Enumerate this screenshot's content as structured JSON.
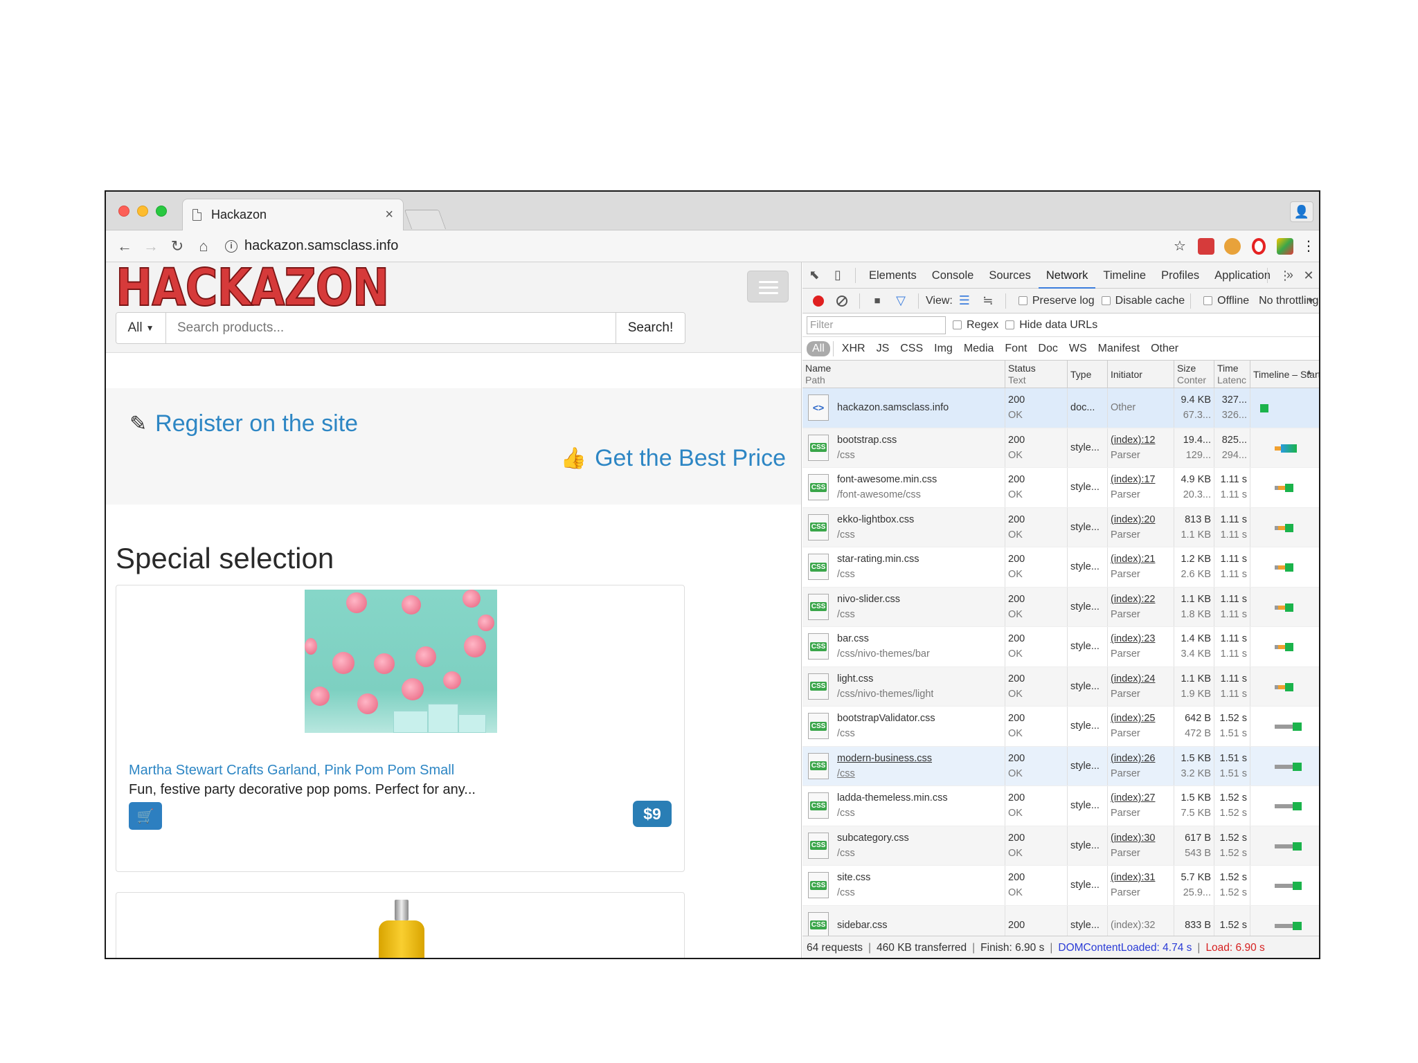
{
  "browser": {
    "tab_title": "Hackazon",
    "tab_close": "×",
    "url": "hackazon.samsclass.info"
  },
  "page": {
    "logo_text": "HACKAZON",
    "search": {
      "category": "All",
      "placeholder": "Search products...",
      "button": "Search!"
    },
    "promo": {
      "register": "Register on the site",
      "best_price": "Get the Best Price"
    },
    "section_title": "Special selection",
    "product": {
      "name": "Martha Stewart Crafts Garland, Pink Pom Pom Small",
      "description": "Fun, festive party decorative pop poms. Perfect for any...",
      "price": "$9"
    }
  },
  "devtools": {
    "tabs": [
      "Elements",
      "Console",
      "Sources",
      "Network",
      "Timeline",
      "Profiles",
      "Application"
    ],
    "active_tab": "Network",
    "toolbar": {
      "view_label": "View:",
      "preserve_log": "Preserve log",
      "disable_cache": "Disable cache",
      "offline": "Offline",
      "throttling": "No throttling"
    },
    "filter": {
      "placeholder": "Filter",
      "regex": "Regex",
      "hide_data_urls": "Hide data URLs"
    },
    "types": [
      "All",
      "XHR",
      "JS",
      "CSS",
      "Img",
      "Media",
      "Font",
      "Doc",
      "WS",
      "Manifest",
      "Other"
    ],
    "columns": {
      "name": "Name",
      "path": "Path",
      "status": "Status",
      "text": "Text",
      "type": "Type",
      "initiator": "Initiator",
      "size": "Size",
      "content": "Conter",
      "time": "Time",
      "latency": "Latenc",
      "timeline": "Timeline – Start Time"
    },
    "rows": [
      {
        "name": "hackazon.samsclass.info",
        "path": "",
        "status": "200",
        "text": "OK",
        "type": "doc...",
        "initiator": "Other",
        "init_sub": "",
        "size": "9.4 KB",
        "content": "67.3...",
        "time": "327...",
        "latency": "326...",
        "icon": "html",
        "start": 0.01,
        "wait": 0.0,
        "recv": 0.05
      },
      {
        "name": "bootstrap.css",
        "path": "/css",
        "status": "200",
        "text": "OK",
        "type": "style...",
        "initiator": "(index):12",
        "init_sub": "Parser",
        "size": "19.4...",
        "content": "129...",
        "time": "825...",
        "latency": "294...",
        "icon": "css",
        "start": 0.12,
        "wait": 0.05,
        "recv": 0.09
      },
      {
        "name": "font-awesome.min.css",
        "path": "/font-awesome/css",
        "status": "200",
        "text": "OK",
        "type": "style...",
        "initiator": "(index):17",
        "init_sub": "Parser",
        "size": "4.9 KB",
        "content": "20.3...",
        "time": "1.11 s",
        "latency": "1.11 s",
        "icon": "css",
        "start": 0.12,
        "wait": 0.08,
        "recv": 0.05
      },
      {
        "name": "ekko-lightbox.css",
        "path": "/css",
        "status": "200",
        "text": "OK",
        "type": "style...",
        "initiator": "(index):20",
        "init_sub": "Parser",
        "size": "813 B",
        "content": "1.1 KB",
        "time": "1.11 s",
        "latency": "1.11 s",
        "icon": "css",
        "start": 0.12,
        "wait": 0.08,
        "recv": 0.05
      },
      {
        "name": "star-rating.min.css",
        "path": "/css",
        "status": "200",
        "text": "OK",
        "type": "style...",
        "initiator": "(index):21",
        "init_sub": "Parser",
        "size": "1.2 KB",
        "content": "2.6 KB",
        "time": "1.11 s",
        "latency": "1.11 s",
        "icon": "css",
        "start": 0.12,
        "wait": 0.08,
        "recv": 0.05
      },
      {
        "name": "nivo-slider.css",
        "path": "/css",
        "status": "200",
        "text": "OK",
        "type": "style...",
        "initiator": "(index):22",
        "init_sub": "Parser",
        "size": "1.1 KB",
        "content": "1.8 KB",
        "time": "1.11 s",
        "latency": "1.11 s",
        "icon": "css",
        "start": 0.12,
        "wait": 0.08,
        "recv": 0.05
      },
      {
        "name": "bar.css",
        "path": "/css/nivo-themes/bar",
        "status": "200",
        "text": "OK",
        "type": "style...",
        "initiator": "(index):23",
        "init_sub": "Parser",
        "size": "1.4 KB",
        "content": "3.4 KB",
        "time": "1.11 s",
        "latency": "1.11 s",
        "icon": "css",
        "start": 0.12,
        "wait": 0.08,
        "recv": 0.05
      },
      {
        "name": "light.css",
        "path": "/css/nivo-themes/light",
        "status": "200",
        "text": "OK",
        "type": "style...",
        "initiator": "(index):24",
        "init_sub": "Parser",
        "size": "1.1 KB",
        "content": "1.9 KB",
        "time": "1.11 s",
        "latency": "1.11 s",
        "icon": "css",
        "start": 0.12,
        "wait": 0.08,
        "recv": 0.05
      },
      {
        "name": "bootstrapValidator.css",
        "path": "/css",
        "status": "200",
        "text": "OK",
        "type": "style...",
        "initiator": "(index):25",
        "init_sub": "Parser",
        "size": "642 B",
        "content": "472 B",
        "time": "1.52 s",
        "latency": "1.51 s",
        "icon": "css",
        "start": 0.12,
        "wait": 0.14,
        "recv": 0.05
      },
      {
        "name": "modern-business.css",
        "path": "/css",
        "status": "200",
        "text": "OK",
        "type": "style...",
        "initiator": "(index):26",
        "init_sub": "Parser",
        "size": "1.5 KB",
        "content": "3.2 KB",
        "time": "1.51 s",
        "latency": "1.51 s",
        "icon": "css",
        "start": 0.12,
        "wait": 0.14,
        "recv": 0.05
      },
      {
        "name": "ladda-themeless.min.css",
        "path": "/css",
        "status": "200",
        "text": "OK",
        "type": "style...",
        "initiator": "(index):27",
        "init_sub": "Parser",
        "size": "1.5 KB",
        "content": "7.5 KB",
        "time": "1.52 s",
        "latency": "1.52 s",
        "icon": "css",
        "start": 0.12,
        "wait": 0.14,
        "recv": 0.05
      },
      {
        "name": "subcategory.css",
        "path": "/css",
        "status": "200",
        "text": "OK",
        "type": "style...",
        "initiator": "(index):30",
        "init_sub": "Parser",
        "size": "617 B",
        "content": "543 B",
        "time": "1.52 s",
        "latency": "1.52 s",
        "icon": "css",
        "start": 0.12,
        "wait": 0.14,
        "recv": 0.05
      },
      {
        "name": "site.css",
        "path": "/css",
        "status": "200",
        "text": "OK",
        "type": "style...",
        "initiator": "(index):31",
        "init_sub": "Parser",
        "size": "5.7 KB",
        "content": "25.9...",
        "time": "1.52 s",
        "latency": "1.52 s",
        "icon": "css",
        "start": 0.12,
        "wait": 0.14,
        "recv": 0.05
      },
      {
        "name": "sidebar.css",
        "path": "",
        "status": "200",
        "text": "",
        "type": "style...",
        "initiator": "(index):32",
        "init_sub": "",
        "size": "833 B",
        "content": "",
        "time": "1.52 s",
        "latency": "",
        "icon": "css",
        "start": 0.12,
        "wait": 0.14,
        "recv": 0.05
      }
    ],
    "statusbar": {
      "requests": "64 requests",
      "transferred": "460 KB transferred",
      "finish": "Finish: 6.90 s",
      "dcl": "DOMContentLoaded: 4.74 s",
      "load": "Load: 6.90 s"
    },
    "colors": {
      "active_tab": "#3b7ddd",
      "waiting": "#1bb34b",
      "stalled": "#9a9a9a",
      "queued": "#f0a030",
      "download": "#2a9be0",
      "load_line": "#e05050"
    }
  }
}
